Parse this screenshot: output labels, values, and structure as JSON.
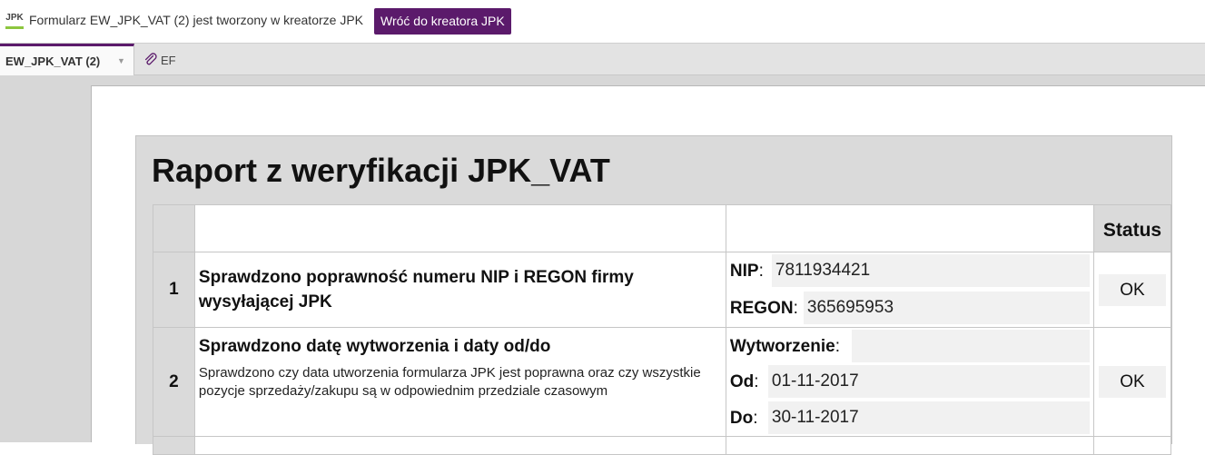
{
  "topbar": {
    "logo_text": "JPK",
    "message": "Formularz EW_JPK_VAT (2) jest tworzony w kreatorze JPK",
    "back_button": "Wróć do kreatora JPK"
  },
  "tabs": {
    "active_label": "EW_JPK_VAT (2)",
    "attachment_label": "EF"
  },
  "report": {
    "title": "Raport z weryfikacji JPK_VAT",
    "status_header": "Status",
    "rows": [
      {
        "num": "1",
        "title": "Sprawdzono poprawność numeru NIP i REGON firmy wysyłającej JPK",
        "fields": [
          {
            "label": "NIP",
            "value": "7811934421"
          },
          {
            "label": "REGON",
            "value": "365695953"
          }
        ],
        "status": "OK"
      },
      {
        "num": "2",
        "title": "Sprawdzono datę wytworzenia i daty od/do",
        "subtitle": "Sprawdzono czy data utworzenia formularza JPK jest poprawna oraz czy wszystkie pozycje sprzedaży/zakupu są w odpowiednim przedziale czasowym",
        "fields": [
          {
            "label": "Wytworzenie",
            "value": ""
          },
          {
            "label": "Od",
            "value": "01-11-2017"
          },
          {
            "label": "Do",
            "value": "30-11-2017"
          }
        ],
        "status": "OK"
      }
    ]
  },
  "colors": {
    "accent": "#5b1a6b",
    "logo_underline": "#8dc63f",
    "workarea_bg": "#d7d7d7",
    "report_bg": "#dadada"
  }
}
